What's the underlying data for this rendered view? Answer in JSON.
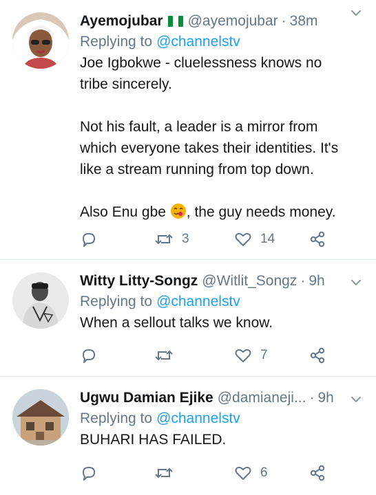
{
  "tweets": [
    {
      "name": "Ayemojubar",
      "handle": "@ayemojubar",
      "time": "38m",
      "replying_label": "Replying to",
      "replying_to": "@channelstv",
      "lines": [
        "Joe Igbokwe - cluelessness knows no",
        "tribe sincerely.",
        "",
        "Not his fault, a leader is a mirror from",
        "which everyone takes their identities. It's",
        "like a stream running from top down.",
        "",
        "Also Enu gbe",
        ", the guy needs money."
      ],
      "retweets": "3",
      "likes": "14"
    },
    {
      "name": "Witty Litty-Songz",
      "handle": "@Witlit_Songz",
      "time": "9h",
      "replying_label": "Replying to",
      "replying_to": "@channelstv",
      "text": "When a sellout talks we know.",
      "retweets": "",
      "likes": "7"
    },
    {
      "name": "Ugwu Damian Ejike",
      "handle": "@damianeji...",
      "time": "9h",
      "replying_label": "Replying to",
      "replying_to": "@channelstv",
      "text": "BUHARI HAS FAILED.",
      "retweets": "",
      "likes": "6"
    }
  ],
  "separator": "·",
  "colors": {
    "accent": "#1da1f2",
    "muted": "#657786",
    "border": "#e1e8ed"
  },
  "icons": [
    "reply-icon",
    "retweet-icon",
    "like-icon",
    "share-icon",
    "chevron-down-icon",
    "nigeria-flag-icon",
    "emoji-icon"
  ]
}
